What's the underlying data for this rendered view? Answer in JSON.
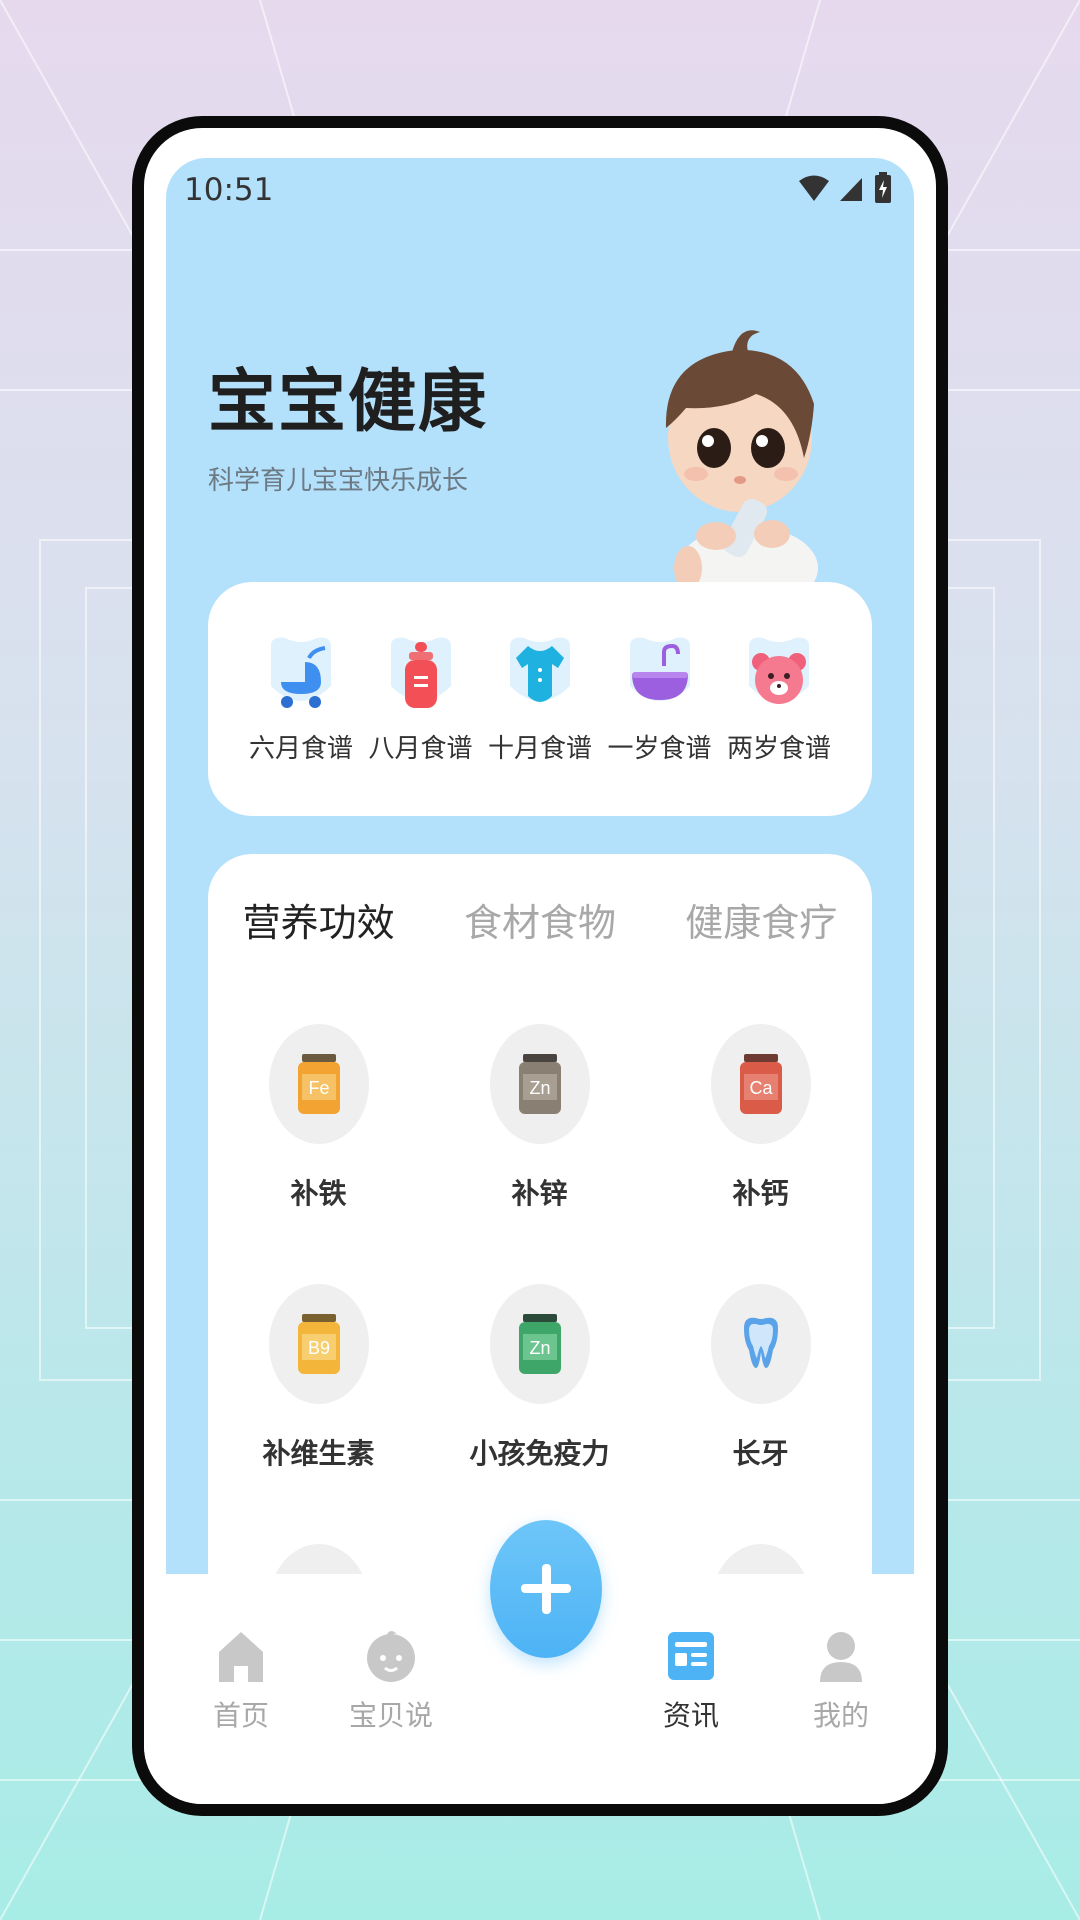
{
  "status_bar": {
    "time": "10:51"
  },
  "hero": {
    "title": "宝宝健康",
    "subtitle": "科学育儿宝宝快乐成长"
  },
  "recipes": [
    {
      "label": "六月食谱",
      "icon": "stroller-icon"
    },
    {
      "label": "八月食谱",
      "icon": "baby-bottle-icon"
    },
    {
      "label": "十月食谱",
      "icon": "onesie-icon"
    },
    {
      "label": "一岁食谱",
      "icon": "bathtub-icon"
    },
    {
      "label": "两岁食谱",
      "icon": "teddy-bear-icon"
    }
  ],
  "tabs": [
    {
      "label": "营养功效",
      "active": true
    },
    {
      "label": "食材食物",
      "active": false
    },
    {
      "label": "健康食疗",
      "active": false
    }
  ],
  "nutrition_items": [
    {
      "label": "补铁",
      "icon": "iron-supplement-icon",
      "badge": "Fe",
      "color": "#f2a331"
    },
    {
      "label": "补锌",
      "icon": "zinc-supplement-icon",
      "badge": "Zn",
      "color": "#8a7f73"
    },
    {
      "label": "补钙",
      "icon": "calcium-supplement-icon",
      "badge": "Ca",
      "color": "#d95b48"
    },
    {
      "label": "补维生素",
      "icon": "vitamin-supplement-icon",
      "badge": "B9",
      "color": "#f3b63a"
    },
    {
      "label": "小孩免疫力",
      "icon": "immunity-supplement-icon",
      "badge": "Zn",
      "color": "#3fa66a"
    },
    {
      "label": "长牙",
      "icon": "tooth-icon",
      "badge": "",
      "color": "#5aa3e8"
    }
  ],
  "bottom_nav": [
    {
      "label": "首页",
      "icon": "home-icon",
      "active": false
    },
    {
      "label": "宝贝说",
      "icon": "baby-face-icon",
      "active": false
    },
    {
      "label": "资讯",
      "icon": "news-icon",
      "active": true
    },
    {
      "label": "我的",
      "icon": "profile-icon",
      "active": false
    }
  ],
  "colors": {
    "accent": "#4db3f5",
    "hero_bg": "#b3e0fb"
  }
}
